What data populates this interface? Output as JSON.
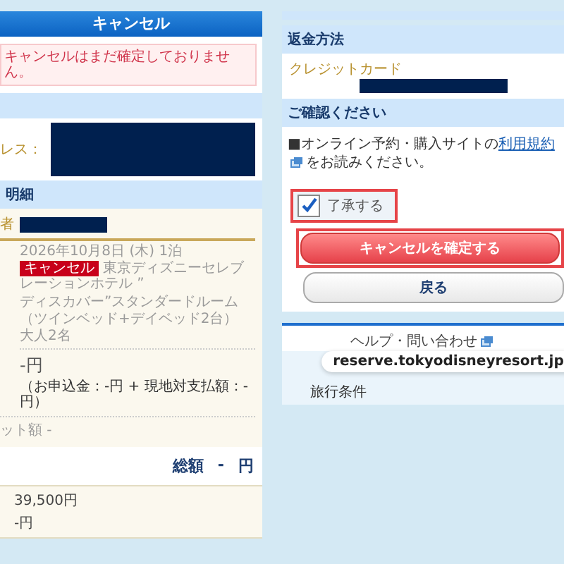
{
  "left": {
    "header": "キャンセル",
    "notice": "キャンセルはまだ確定しておりません。",
    "address_label": "レス：",
    "details_band": "明細",
    "name_label": "者",
    "stay": {
      "date": "2026年10月8日 (木) 1泊",
      "tag": "キャンセル",
      "hotel": "東京ディズニーセレブレーションホテル ”",
      "room": "ディスカバー”スタンダードルーム",
      "beds": "（ツインベッド+デイベッド2台）",
      "guests": "大人2名"
    },
    "price": "-円",
    "price_note": "（お申込金：-円 + 現地対支払額：-円）",
    "ticket": "ット額 -",
    "total": {
      "label": "総額",
      "value": "-",
      "unit": "円"
    },
    "amounts": [
      "39,500円",
      "-円"
    ]
  },
  "right": {
    "refund_band": "返金方法",
    "refund_method": "クレジットカード",
    "confirm_band": "ご確認ください",
    "terms": {
      "before": "■オンライン予約・購入サイトの",
      "link": "利用規約",
      "after": "をお読みください。"
    },
    "agree": {
      "label": "了承する",
      "checked": true
    },
    "confirm_button": "キャンセルを確定する",
    "back_button": "戻る",
    "help": "ヘルプ・問い合わせ",
    "footer_link": "旅行条件",
    "tooltip": "reserve.tokyodisneyresort.jp"
  }
}
